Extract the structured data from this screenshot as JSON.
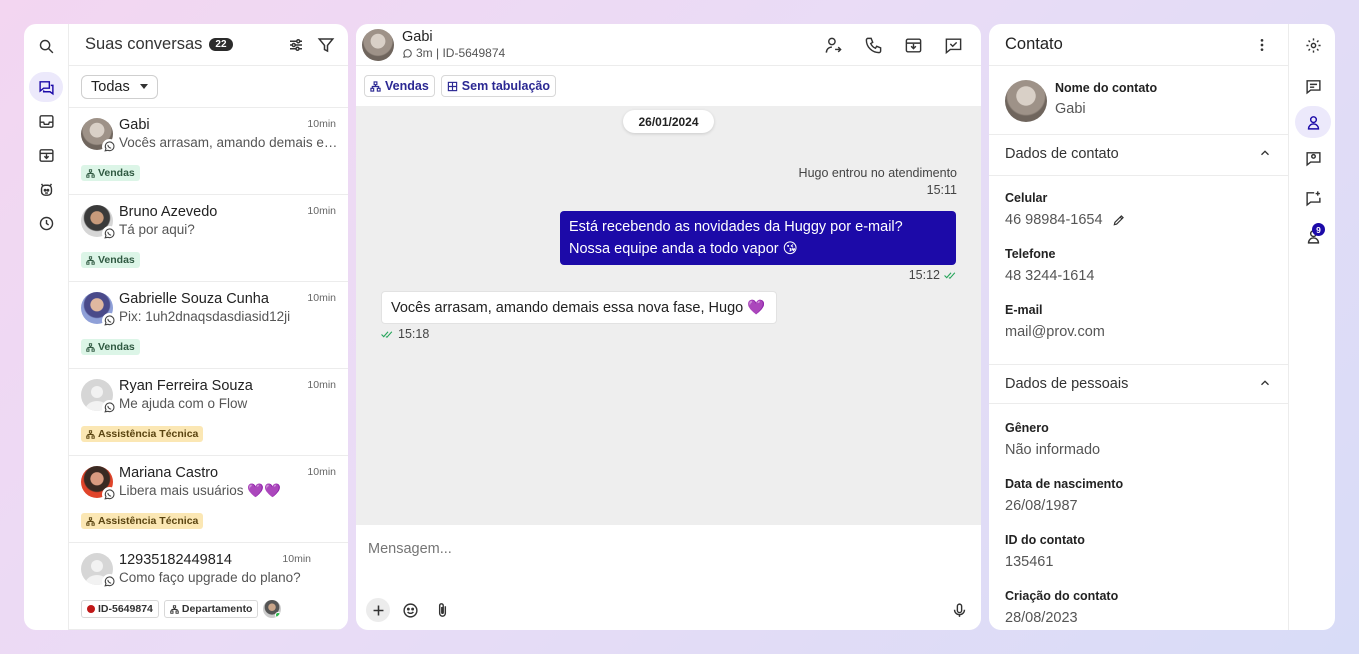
{
  "rail": {
    "icons": [
      "search-icon",
      "chats-icon",
      "inbox-icon",
      "archive-icon",
      "bot-icon",
      "history-icon"
    ]
  },
  "conversations": {
    "title": "Suas conversas",
    "count": "22",
    "filter_value": "Todas",
    "items": [
      {
        "name": "Gabi",
        "time": "10min",
        "preview": "Vocês arrasam, amando demais essa nova fase, Hugo 💜",
        "tag": "Vendas"
      },
      {
        "name": "Bruno Azevedo",
        "time": "10min",
        "preview": "Tá por aqui?",
        "tag": "Vendas"
      },
      {
        "name": "Gabrielle Souza Cunha",
        "time": "10min",
        "preview": "Pix: 1uh2dnaqsdasdiasid12ji",
        "tag": "Vendas"
      },
      {
        "name": "Ryan Ferreira Souza",
        "time": "10min",
        "preview": "Me ajuda com o Flow",
        "tag": "Assistência Técnica"
      },
      {
        "name": "Mariana Castro",
        "time": "10min",
        "preview": "Libera mais usuários 💜💜",
        "tag": "Assistência Técnica"
      },
      {
        "name": "12935182449814",
        "time": "10min",
        "preview": "Como faço upgrade do plano?",
        "tag_id": "ID-5649874",
        "tag": "Departamento"
      }
    ]
  },
  "chat": {
    "name": "Gabi",
    "sub": "3m | ID-5649874",
    "tags": [
      "Vendas",
      "Sem tabulação"
    ],
    "date": "26/01/2024",
    "system_msg": "Hugo entrou no atendimento",
    "system_time": "15:11",
    "out_msg": "Está recebendo as novidades da Huggy por e-mail? Nossa equipe anda a todo vapor 😘",
    "out_time": "15:12",
    "in_msg": "Vocês arrasam, amando demais essa nova fase, Hugo 💜",
    "in_time": "15:18",
    "placeholder": "Mensagem..."
  },
  "contact": {
    "title": "Contato",
    "name_label": "Nome do contato",
    "name_value": "Gabi",
    "section1": "Dados de contato",
    "cel_label": "Celular",
    "cel_value": "46 98984-1654",
    "tel_label": "Telefone",
    "tel_value": "48 3244-1614",
    "email_label": "E-mail",
    "email_value": "mail@prov.com",
    "section2": "Dados de pessoais",
    "gender_label": "Gênero",
    "gender_value": "Não informado",
    "birth_label": "Data de nascimento",
    "birth_value": "26/08/1987",
    "id_label": "ID do contato",
    "id_value": "135461",
    "created_label": "Criação do contato",
    "created_value": "28/08/2023",
    "badge": "9"
  },
  "colors": {
    "accent": "#1c0aa8",
    "vendas_bg": "#dcf5e7",
    "assist_bg": "#fbe7b4",
    "whatsapp": "#25d366"
  }
}
